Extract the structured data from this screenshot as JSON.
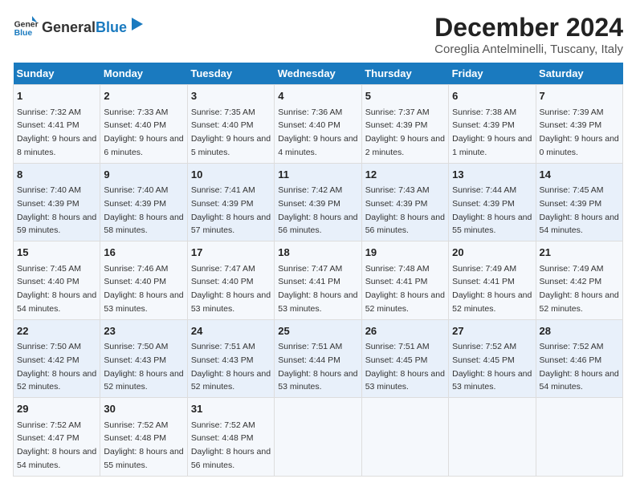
{
  "header": {
    "logo_general": "General",
    "logo_blue": "Blue",
    "title": "December 2024",
    "subtitle": "Coreglia Antelminelli, Tuscany, Italy"
  },
  "days_of_week": [
    "Sunday",
    "Monday",
    "Tuesday",
    "Wednesday",
    "Thursday",
    "Friday",
    "Saturday"
  ],
  "weeks": [
    [
      {
        "day": "1",
        "sunrise": "7:32 AM",
        "sunset": "4:41 PM",
        "daylight": "9 hours and 8 minutes."
      },
      {
        "day": "2",
        "sunrise": "7:33 AM",
        "sunset": "4:40 PM",
        "daylight": "9 hours and 6 minutes."
      },
      {
        "day": "3",
        "sunrise": "7:35 AM",
        "sunset": "4:40 PM",
        "daylight": "9 hours and 5 minutes."
      },
      {
        "day": "4",
        "sunrise": "7:36 AM",
        "sunset": "4:40 PM",
        "daylight": "9 hours and 4 minutes."
      },
      {
        "day": "5",
        "sunrise": "7:37 AM",
        "sunset": "4:39 PM",
        "daylight": "9 hours and 2 minutes."
      },
      {
        "day": "6",
        "sunrise": "7:38 AM",
        "sunset": "4:39 PM",
        "daylight": "9 hours and 1 minute."
      },
      {
        "day": "7",
        "sunrise": "7:39 AM",
        "sunset": "4:39 PM",
        "daylight": "9 hours and 0 minutes."
      }
    ],
    [
      {
        "day": "8",
        "sunrise": "7:40 AM",
        "sunset": "4:39 PM",
        "daylight": "8 hours and 59 minutes."
      },
      {
        "day": "9",
        "sunrise": "7:40 AM",
        "sunset": "4:39 PM",
        "daylight": "8 hours and 58 minutes."
      },
      {
        "day": "10",
        "sunrise": "7:41 AM",
        "sunset": "4:39 PM",
        "daylight": "8 hours and 57 minutes."
      },
      {
        "day": "11",
        "sunrise": "7:42 AM",
        "sunset": "4:39 PM",
        "daylight": "8 hours and 56 minutes."
      },
      {
        "day": "12",
        "sunrise": "7:43 AM",
        "sunset": "4:39 PM",
        "daylight": "8 hours and 56 minutes."
      },
      {
        "day": "13",
        "sunrise": "7:44 AM",
        "sunset": "4:39 PM",
        "daylight": "8 hours and 55 minutes."
      },
      {
        "day": "14",
        "sunrise": "7:45 AM",
        "sunset": "4:39 PM",
        "daylight": "8 hours and 54 minutes."
      }
    ],
    [
      {
        "day": "15",
        "sunrise": "7:45 AM",
        "sunset": "4:40 PM",
        "daylight": "8 hours and 54 minutes."
      },
      {
        "day": "16",
        "sunrise": "7:46 AM",
        "sunset": "4:40 PM",
        "daylight": "8 hours and 53 minutes."
      },
      {
        "day": "17",
        "sunrise": "7:47 AM",
        "sunset": "4:40 PM",
        "daylight": "8 hours and 53 minutes."
      },
      {
        "day": "18",
        "sunrise": "7:47 AM",
        "sunset": "4:41 PM",
        "daylight": "8 hours and 53 minutes."
      },
      {
        "day": "19",
        "sunrise": "7:48 AM",
        "sunset": "4:41 PM",
        "daylight": "8 hours and 52 minutes."
      },
      {
        "day": "20",
        "sunrise": "7:49 AM",
        "sunset": "4:41 PM",
        "daylight": "8 hours and 52 minutes."
      },
      {
        "day": "21",
        "sunrise": "7:49 AM",
        "sunset": "4:42 PM",
        "daylight": "8 hours and 52 minutes."
      }
    ],
    [
      {
        "day": "22",
        "sunrise": "7:50 AM",
        "sunset": "4:42 PM",
        "daylight": "8 hours and 52 minutes."
      },
      {
        "day": "23",
        "sunrise": "7:50 AM",
        "sunset": "4:43 PM",
        "daylight": "8 hours and 52 minutes."
      },
      {
        "day": "24",
        "sunrise": "7:51 AM",
        "sunset": "4:43 PM",
        "daylight": "8 hours and 52 minutes."
      },
      {
        "day": "25",
        "sunrise": "7:51 AM",
        "sunset": "4:44 PM",
        "daylight": "8 hours and 53 minutes."
      },
      {
        "day": "26",
        "sunrise": "7:51 AM",
        "sunset": "4:45 PM",
        "daylight": "8 hours and 53 minutes."
      },
      {
        "day": "27",
        "sunrise": "7:52 AM",
        "sunset": "4:45 PM",
        "daylight": "8 hours and 53 minutes."
      },
      {
        "day": "28",
        "sunrise": "7:52 AM",
        "sunset": "4:46 PM",
        "daylight": "8 hours and 54 minutes."
      }
    ],
    [
      {
        "day": "29",
        "sunrise": "7:52 AM",
        "sunset": "4:47 PM",
        "daylight": "8 hours and 54 minutes."
      },
      {
        "day": "30",
        "sunrise": "7:52 AM",
        "sunset": "4:48 PM",
        "daylight": "8 hours and 55 minutes."
      },
      {
        "day": "31",
        "sunrise": "7:52 AM",
        "sunset": "4:48 PM",
        "daylight": "8 hours and 56 minutes."
      },
      null,
      null,
      null,
      null
    ]
  ]
}
